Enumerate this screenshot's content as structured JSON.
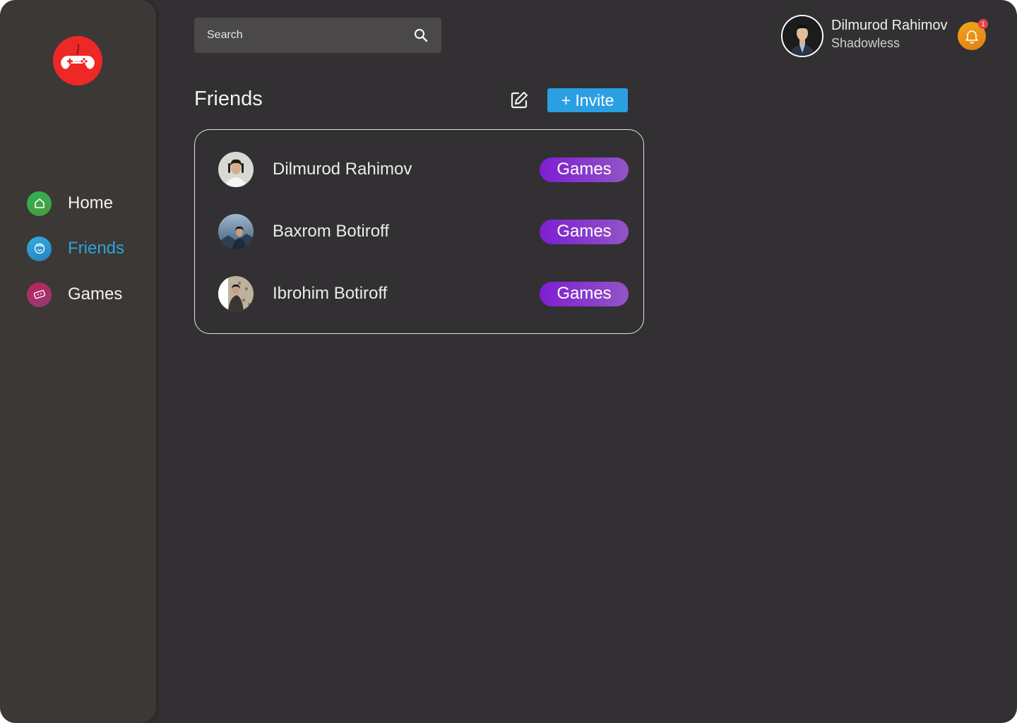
{
  "logo": {
    "icon": "gamepad-icon",
    "color": "#ee2727"
  },
  "sidebar": {
    "items": [
      {
        "label": "Home",
        "icon": "home-icon",
        "color": "#3aa84a"
      },
      {
        "label": "Friends",
        "icon": "smile-icon",
        "color": "#2fa3dd",
        "active": true
      },
      {
        "label": "Games",
        "icon": "ticket-icon",
        "color": "#c72a4a"
      }
    ]
  },
  "search": {
    "placeholder": "Search",
    "value": ""
  },
  "header": {
    "user_name": "Dilmurod Rahimov",
    "user_handle": "Shadowless",
    "notifications_count": "1"
  },
  "friends": {
    "title": "Friends",
    "invite_label": "+ Invite",
    "items": [
      {
        "name": "Dilmurod Rahimov",
        "action": "Games"
      },
      {
        "name": "Baxrom Botiroff",
        "action": "Games"
      },
      {
        "name": "Ibrohim Botiroff",
        "action": "Games"
      }
    ]
  },
  "colors": {
    "background": "#323032",
    "sidebar": "#3b3835",
    "accent": "#2a9fe2",
    "games_button": "#7d1fd1",
    "notification": "#f3a81a"
  }
}
